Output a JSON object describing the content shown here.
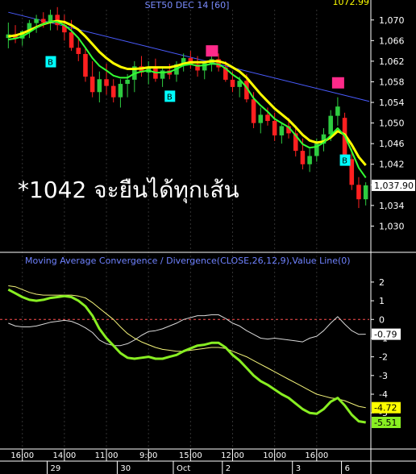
{
  "header": {
    "title": "SET50 DEC 14  [60]",
    "corner_value": "1072.99"
  },
  "annotation": "*1042 จะยืนได้ทุกเส้น",
  "chart_data": [
    {
      "type": "candlestick",
      "title": "SET50 DEC 14  [60]",
      "ylim": [
        1026,
        1072
      ],
      "y_ticks": [
        "1,070",
        "1,066",
        "1,062",
        "1,058",
        "1,054",
        "1,050",
        "1,046",
        "1,042",
        "1,038",
        "1,034",
        "1,030"
      ],
      "last_price_label": "1,037.90",
      "colors": {
        "up": "#2ecc40",
        "down": "#ff2020",
        "ma_fast": "#33ff33",
        "ma_slow": "#ffff00",
        "trendline": "#4a5cff",
        "buy_marker": "#00ffff",
        "sell_marker": "#ff2a8a"
      },
      "candles": [
        [
          1066.5,
          1069.5,
          1064.5,
          1067.2
        ],
        [
          1067.2,
          1069,
          1065.5,
          1066.4
        ],
        [
          1066.4,
          1068,
          1065,
          1067.8
        ],
        [
          1067.8,
          1070,
          1066.5,
          1069.4
        ],
        [
          1069.4,
          1071,
          1067.5,
          1070.2
        ],
        [
          1070.2,
          1071.5,
          1068.5,
          1069.5
        ],
        [
          1069.5,
          1072,
          1068,
          1071
        ],
        [
          1071,
          1072.5,
          1068,
          1069
        ],
        [
          1069,
          1071,
          1066,
          1067.6
        ],
        [
          1067.6,
          1070,
          1064,
          1064.6
        ],
        [
          1064.6,
          1066.5,
          1062,
          1063.4
        ],
        [
          1063.4,
          1064.5,
          1058,
          1059
        ],
        [
          1059,
          1062,
          1055,
          1056
        ],
        [
          1056,
          1060,
          1054,
          1058.5
        ],
        [
          1058.5,
          1061.5,
          1055.5,
          1057.2
        ],
        [
          1057.2,
          1058.5,
          1054,
          1055
        ],
        [
          1055,
          1058.5,
          1053,
          1057.6
        ],
        [
          1057.6,
          1059.5,
          1055,
          1058.4
        ],
        [
          1058.4,
          1062,
          1056,
          1061
        ],
        [
          1061,
          1063,
          1059,
          1059.8
        ],
        [
          1059.8,
          1062,
          1057.5,
          1060.6
        ],
        [
          1060.6,
          1062.5,
          1058,
          1058.6
        ],
        [
          1058.6,
          1061,
          1057,
          1060.2
        ],
        [
          1060.2,
          1061.5,
          1058.5,
          1059.4
        ],
        [
          1059.4,
          1062,
          1058,
          1061.4
        ],
        [
          1061.4,
          1063.5,
          1060,
          1062.6
        ],
        [
          1062.6,
          1064,
          1060.5,
          1061.4
        ],
        [
          1061.4,
          1063,
          1059,
          1060.2
        ],
        [
          1060.2,
          1062,
          1058.5,
          1061.6
        ],
        [
          1061.6,
          1063,
          1060,
          1062.4
        ],
        [
          1062.4,
          1063.5,
          1060,
          1060.8
        ],
        [
          1060.8,
          1062,
          1058,
          1058.4
        ],
        [
          1058.4,
          1060,
          1056,
          1057
        ],
        [
          1057,
          1059,
          1055,
          1058.2
        ],
        [
          1058.2,
          1059.5,
          1054,
          1054.6
        ],
        [
          1054.6,
          1056,
          1049,
          1050
        ],
        [
          1050,
          1053,
          1048,
          1051.6
        ],
        [
          1051.6,
          1053,
          1049.5,
          1050.4
        ],
        [
          1050.4,
          1052,
          1046.5,
          1047.6
        ],
        [
          1047.6,
          1050,
          1046,
          1049.4
        ],
        [
          1049.4,
          1051,
          1047,
          1048
        ],
        [
          1048,
          1049.5,
          1043.5,
          1044.6
        ],
        [
          1044.6,
          1047,
          1041,
          1042
        ],
        [
          1042,
          1045,
          1040.5,
          1043.6
        ],
        [
          1043.6,
          1047,
          1042.5,
          1046
        ],
        [
          1046,
          1049,
          1044.5,
          1047.8
        ],
        [
          1047.8,
          1052.5,
          1046.5,
          1051.4
        ],
        [
          1051.4,
          1055,
          1049.5,
          1053.2
        ],
        [
          1051,
          1052,
          1042,
          1043
        ],
        [
          1043,
          1045,
          1037,
          1038
        ],
        [
          1038,
          1039.5,
          1033.5,
          1035.2
        ],
        [
          1035.2,
          1038.5,
          1034,
          1037.9
        ]
      ],
      "ma_fast": [
        1066.2,
        1066.4,
        1066.8,
        1067.6,
        1068.5,
        1069.2,
        1069.7,
        1069.6,
        1069,
        1067.9,
        1066.5,
        1064.6,
        1062.6,
        1061.1,
        1060.2,
        1059.2,
        1058.8,
        1058.8,
        1059.6,
        1060,
        1060.2,
        1059.8,
        1059.8,
        1059.9,
        1060.5,
        1061.2,
        1061.4,
        1061.1,
        1061.2,
        1061.5,
        1061.4,
        1060.6,
        1059.4,
        1058.5,
        1056.9,
        1054.8,
        1053.4,
        1052.2,
        1050.8,
        1050,
        1049.2,
        1047.6,
        1045.9,
        1045.2,
        1045.4,
        1046.2,
        1047.6,
        1049,
        1047.5,
        1044.5,
        1041.3,
        1039.4
      ],
      "ma_slow": [
        1066.8,
        1067,
        1067.4,
        1068,
        1068.6,
        1069.2,
        1069.6,
        1069.8,
        1069.6,
        1069,
        1068.1,
        1066.8,
        1065.3,
        1063.8,
        1062.6,
        1061.6,
        1060.9,
        1060.5,
        1060.5,
        1060.6,
        1060.8,
        1060.8,
        1060.8,
        1060.8,
        1061.1,
        1061.5,
        1061.8,
        1061.8,
        1061.8,
        1062,
        1062,
        1061.6,
        1060.8,
        1060,
        1058.8,
        1057.2,
        1055.6,
        1054.2,
        1052.8,
        1051.7,
        1050.6,
        1049.2,
        1047.7,
        1046.6,
        1046.2,
        1046.4,
        1047.2,
        1048.4,
        1047.8,
        1045.8,
        1043.4,
        1041.8
      ],
      "trendline": [
        [
          0,
          1071.5
        ],
        [
          51,
          1054.2
        ]
      ],
      "buy_markers": [
        {
          "bar": 6,
          "price": 1061.9,
          "label": "B"
        },
        {
          "bar": 23,
          "price": 1055.2,
          "label": "B"
        },
        {
          "bar": 48,
          "price": 1042.8,
          "label": "B"
        }
      ],
      "sell_markers": [
        {
          "bar": 29,
          "price": 1064
        },
        {
          "bar": 47,
          "price": 1057.8
        }
      ]
    },
    {
      "type": "line",
      "title": "Moving Average Convergence / Divergence(CLOSE,26,12,9),Value Line(0)",
      "ylim": [
        -6.2,
        2.6
      ],
      "y_ticks": [
        "2",
        "1",
        "0",
        "-1",
        "-2",
        "-3",
        "-4",
        "-5"
      ],
      "zero_line": 0,
      "labels": {
        "value": "-0.79",
        "macd": "-5.51",
        "signal": "-4.72"
      },
      "series": [
        {
          "key": "macd",
          "color": "#88ee22",
          "width": 3,
          "values": [
            1.6,
            1.4,
            1.2,
            1.05,
            1.0,
            1.05,
            1.15,
            1.2,
            1.25,
            1.2,
            1.0,
            0.7,
            0.2,
            -0.5,
            -1.0,
            -1.4,
            -1.8,
            -2.05,
            -2.1,
            -2.05,
            -2.0,
            -2.1,
            -2.1,
            -2.0,
            -1.9,
            -1.7,
            -1.55,
            -1.4,
            -1.35,
            -1.25,
            -1.25,
            -1.5,
            -1.9,
            -2.2,
            -2.6,
            -3.0,
            -3.3,
            -3.5,
            -3.75,
            -4.0,
            -4.2,
            -4.5,
            -4.8,
            -5.0,
            -5.05,
            -4.8,
            -4.4,
            -4.2,
            -4.6,
            -5.1,
            -5.45,
            -5.51
          ]
        },
        {
          "key": "signal",
          "color": "#f4f47a",
          "width": 1,
          "values": [
            1.8,
            1.75,
            1.6,
            1.45,
            1.35,
            1.3,
            1.3,
            1.3,
            1.3,
            1.3,
            1.25,
            1.15,
            0.9,
            0.6,
            0.3,
            0.0,
            -0.4,
            -0.75,
            -1.0,
            -1.2,
            -1.35,
            -1.5,
            -1.6,
            -1.65,
            -1.7,
            -1.7,
            -1.65,
            -1.6,
            -1.55,
            -1.5,
            -1.5,
            -1.55,
            -1.7,
            -1.85,
            -2.0,
            -2.2,
            -2.4,
            -2.6,
            -2.8,
            -3.0,
            -3.2,
            -3.4,
            -3.6,
            -3.8,
            -4.0,
            -4.1,
            -4.2,
            -4.25,
            -4.35,
            -4.5,
            -4.65,
            -4.72
          ]
        },
        {
          "key": "value",
          "color": "#d8d8d8",
          "width": 1,
          "values": [
            -0.2,
            -0.35,
            -0.4,
            -0.4,
            -0.35,
            -0.25,
            -0.15,
            -0.1,
            -0.05,
            -0.1,
            -0.25,
            -0.45,
            -0.7,
            -1.1,
            -1.3,
            -1.4,
            -1.4,
            -1.3,
            -1.1,
            -0.85,
            -0.65,
            -0.6,
            -0.5,
            -0.35,
            -0.2,
            0.0,
            0.1,
            0.2,
            0.2,
            0.25,
            0.25,
            0.05,
            -0.2,
            -0.35,
            -0.6,
            -0.8,
            -1.0,
            -1.05,
            -1.0,
            -1.05,
            -1.1,
            -1.15,
            -1.2,
            -1.0,
            -0.9,
            -0.6,
            -0.2,
            0.15,
            -0.25,
            -0.6,
            -0.8,
            -0.79
          ]
        }
      ]
    }
  ],
  "x_axis": {
    "times": [
      {
        "bar": 2,
        "label": "16:00"
      },
      {
        "bar": 8,
        "label": "14:00"
      },
      {
        "bar": 14,
        "label": "11:00"
      },
      {
        "bar": 20,
        "label": "9:00"
      },
      {
        "bar": 26,
        "label": "15:00"
      },
      {
        "bar": 32,
        "label": "12:00"
      },
      {
        "bar": 38,
        "label": "10:00"
      },
      {
        "bar": 44,
        "label": "16:00"
      }
    ],
    "dates": [
      {
        "bar": 6,
        "label": "29"
      },
      {
        "bar": 16,
        "label": "30"
      },
      {
        "bar": 24,
        "label": "Oct"
      },
      {
        "bar": 31,
        "label": "2"
      },
      {
        "bar": 41,
        "label": "3"
      },
      {
        "bar": 48,
        "label": "6"
      }
    ]
  }
}
